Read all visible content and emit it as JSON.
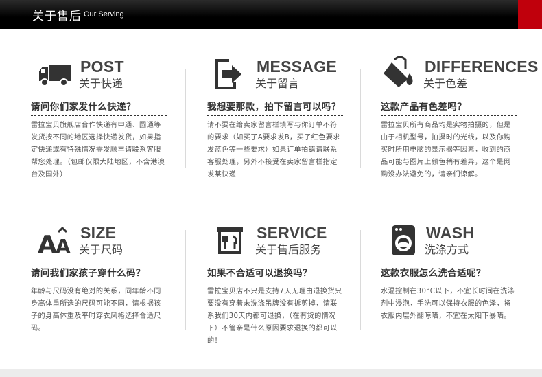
{
  "header": {
    "title": "关于售后",
    "subtitle": "Our Serving"
  },
  "items": [
    {
      "en": "POST",
      "cn": "关于快递",
      "icon": "truck-icon",
      "question": "请问你们家发什么快递？",
      "answer": "雷拉宝贝旗舰店合作快递有申通、圆通等发货按不同的地区选择快递发货，如果指定快递或有特殊情况需发顺丰请联系客服帮您处理。（包邮仅限大陆地区，不含港澳台及国外）"
    },
    {
      "en": "MESSAGE",
      "cn": "关于留言",
      "icon": "message-icon",
      "question": "我想要那款，拍下留言可以吗？",
      "answer": "请不要在给卖家留言栏填写与你订单不符的要求（如买了A要求发B，买了红色要求发蓝色等一些要求）如果订单拍错请联系客服处理，另外不接受在卖家留言栏指定发某快递"
    },
    {
      "en": "DIFFERENCES",
      "cn": "关于色差",
      "icon": "paint-bucket-icon",
      "question": "这款产品有色差吗？",
      "answer": "雷拉宝贝所有商品均是实物拍摄的，但是由于相机型号，拍摄时的光线，以及你购买时所用电脑的显示器等因素，收到的商品可能与图片上颜色稍有差异，这个是网购没办法避免的，请亲们谅解。"
    },
    {
      "en": "SIZE",
      "cn": "关于尺码",
      "icon": "font-size-icon",
      "question": "请问我们家孩子穿什么码？",
      "answer": "年龄与尺码没有绝对的关系，同年龄不同身高体重所选的尺码可能不同，请根据孩子的身高体重及平时穿衣风格选择合适尺码。"
    },
    {
      "en": "SERVICE",
      "cn": "关于售后服务",
      "icon": "service-icon",
      "question": "如果不合适可以退换吗？",
      "answer": "雷拉宝贝店不只是支持7天无理由退换货只要没有穿着未洗涤吊牌没有拆剪掉，请联系我们30天内都可退换，（在有货的情况下）不管亲是什么原因要求退换的都可以的！"
    },
    {
      "en": "WASH",
      "cn": "洗涤方式",
      "icon": "washing-machine-icon",
      "question": "这款衣服怎么洗合适呢？",
      "answer": "水温控制在30°C以下，不宜长时间在洗涤剂中浸泡，手洗可以保持衣服的色泽，将衣服内层外翻晾晒，不宜在太阳下暴晒。"
    }
  ]
}
